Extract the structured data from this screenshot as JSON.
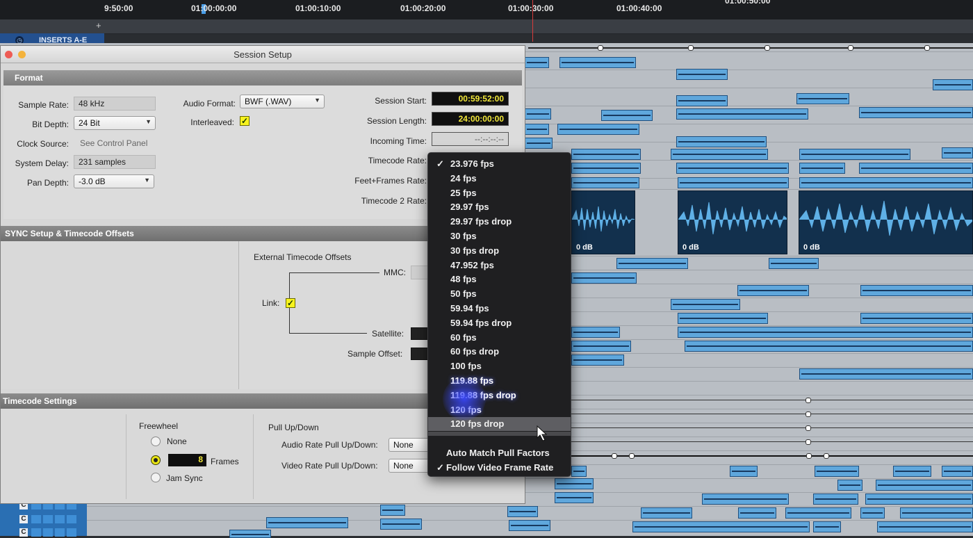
{
  "timeline": {
    "ticks": [
      "9:50:00",
      "01:00:00:00",
      "01:00:10:00",
      "01:00:20:00",
      "01:00:30:00",
      "01:00:40:00",
      "01:00:50:00"
    ],
    "inserts_label": "INSERTS A-E",
    "add_symbol": "+",
    "clip_gain": [
      "0 dB",
      "0 dB",
      "0 dB"
    ],
    "track_buttons": [
      "C",
      "C",
      "C"
    ]
  },
  "window": {
    "title": "Session Setup",
    "colors": {
      "close": "#ee5c55",
      "minimize": "#f4b33c",
      "timecode_text": "#f3e93a",
      "checkbox": "#f7f31e"
    }
  },
  "format": {
    "header": "Format",
    "sample_rate_label": "Sample Rate:",
    "sample_rate_value": "48 kHz",
    "bit_depth_label": "Bit Depth:",
    "bit_depth_value": "24 Bit",
    "clock_source_label": "Clock Source:",
    "clock_source_value": "See Control Panel",
    "system_delay_label": "System Delay:",
    "system_delay_value": "231 samples",
    "pan_depth_label": "Pan Depth:",
    "pan_depth_value": "-3.0 dB",
    "audio_format_label": "Audio Format:",
    "audio_format_value": "BWF (.WAV)",
    "interleaved_label": "Interleaved:",
    "interleaved_checked": true,
    "session_start_label": "Session Start:",
    "session_start_value": "00:59:52:00",
    "session_length_label": "Session Length:",
    "session_length_value": "24:00:00:00",
    "incoming_time_label": "Incoming Time:",
    "incoming_time_value": "--:--:--:--",
    "timecode_rate_label": "Timecode Rate:",
    "feet_frames_label": "Feet+Frames Rate:",
    "timecode2_label": "Timecode 2 Rate:"
  },
  "sync": {
    "header": "SYNC Setup & Timecode Offsets",
    "external_offsets_label": "External Timecode Offsets",
    "mmc_label": "MMC:",
    "link_label": "Link:",
    "link_checked": true,
    "satellite_label": "Satellite:",
    "sample_offset_label": "Sample Offset:"
  },
  "timecode_settings": {
    "header": "Timecode Settings",
    "freewheel_label": "Freewheel",
    "none_label": "None",
    "frames_value": "8",
    "frames_label": "Frames",
    "jam_sync_label": "Jam Sync",
    "selected": "Frames",
    "pull_label": "Pull Up/Down",
    "audio_pull_label": "Audio Rate Pull Up/Down:",
    "audio_pull_value": "None",
    "video_pull_label": "Video Rate Pull Up/Down:",
    "video_pull_value": "None"
  },
  "menu": {
    "check_glyph": "✓",
    "items": [
      {
        "label": "23.976 fps",
        "checked": true
      },
      {
        "label": "24 fps"
      },
      {
        "label": "25 fps"
      },
      {
        "label": "29.97 fps"
      },
      {
        "label": "29.97 fps drop"
      },
      {
        "label": "30 fps"
      },
      {
        "label": "30 fps drop"
      },
      {
        "label": "47.952 fps"
      },
      {
        "label": "48 fps"
      },
      {
        "label": "50 fps"
      },
      {
        "label": "59.94 fps"
      },
      {
        "label": "59.94 fps drop"
      },
      {
        "label": "60 fps"
      },
      {
        "label": "60 fps drop"
      },
      {
        "label": "100 fps"
      },
      {
        "label": "119.88 fps"
      },
      {
        "label": "119.88 fps drop"
      },
      {
        "label": "120 fps"
      },
      {
        "label": "120 fps drop",
        "highlighted": true
      }
    ],
    "options": [
      {
        "label": "Auto Match Pull Factors",
        "checked": false
      },
      {
        "label": "Follow Video Frame Rate",
        "checked": true
      }
    ]
  }
}
